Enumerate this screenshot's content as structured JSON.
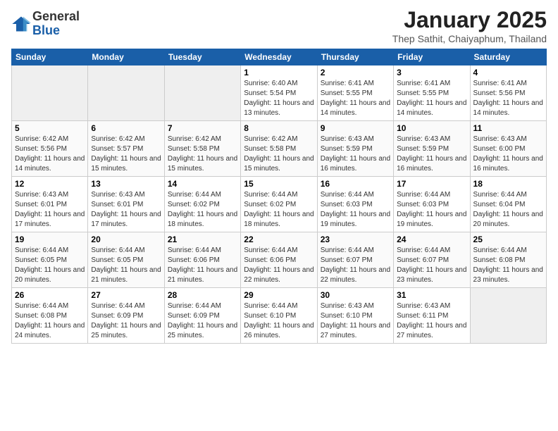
{
  "logo": {
    "general": "General",
    "blue": "Blue"
  },
  "header": {
    "month": "January 2025",
    "location": "Thep Sathit, Chaiyaphum, Thailand"
  },
  "weekdays": [
    "Sunday",
    "Monday",
    "Tuesday",
    "Wednesday",
    "Thursday",
    "Friday",
    "Saturday"
  ],
  "weeks": [
    [
      {
        "day": null
      },
      {
        "day": null
      },
      {
        "day": null
      },
      {
        "day": "1",
        "sunrise": "6:40 AM",
        "sunset": "5:54 PM",
        "daylight": "11 hours and 13 minutes."
      },
      {
        "day": "2",
        "sunrise": "6:41 AM",
        "sunset": "5:55 PM",
        "daylight": "11 hours and 14 minutes."
      },
      {
        "day": "3",
        "sunrise": "6:41 AM",
        "sunset": "5:55 PM",
        "daylight": "11 hours and 14 minutes."
      },
      {
        "day": "4",
        "sunrise": "6:41 AM",
        "sunset": "5:56 PM",
        "daylight": "11 hours and 14 minutes."
      }
    ],
    [
      {
        "day": "5",
        "sunrise": "6:42 AM",
        "sunset": "5:56 PM",
        "daylight": "11 hours and 14 minutes."
      },
      {
        "day": "6",
        "sunrise": "6:42 AM",
        "sunset": "5:57 PM",
        "daylight": "11 hours and 15 minutes."
      },
      {
        "day": "7",
        "sunrise": "6:42 AM",
        "sunset": "5:58 PM",
        "daylight": "11 hours and 15 minutes."
      },
      {
        "day": "8",
        "sunrise": "6:42 AM",
        "sunset": "5:58 PM",
        "daylight": "11 hours and 15 minutes."
      },
      {
        "day": "9",
        "sunrise": "6:43 AM",
        "sunset": "5:59 PM",
        "daylight": "11 hours and 16 minutes."
      },
      {
        "day": "10",
        "sunrise": "6:43 AM",
        "sunset": "5:59 PM",
        "daylight": "11 hours and 16 minutes."
      },
      {
        "day": "11",
        "sunrise": "6:43 AM",
        "sunset": "6:00 PM",
        "daylight": "11 hours and 16 minutes."
      }
    ],
    [
      {
        "day": "12",
        "sunrise": "6:43 AM",
        "sunset": "6:01 PM",
        "daylight": "11 hours and 17 minutes."
      },
      {
        "day": "13",
        "sunrise": "6:43 AM",
        "sunset": "6:01 PM",
        "daylight": "11 hours and 17 minutes."
      },
      {
        "day": "14",
        "sunrise": "6:44 AM",
        "sunset": "6:02 PM",
        "daylight": "11 hours and 18 minutes."
      },
      {
        "day": "15",
        "sunrise": "6:44 AM",
        "sunset": "6:02 PM",
        "daylight": "11 hours and 18 minutes."
      },
      {
        "day": "16",
        "sunrise": "6:44 AM",
        "sunset": "6:03 PM",
        "daylight": "11 hours and 19 minutes."
      },
      {
        "day": "17",
        "sunrise": "6:44 AM",
        "sunset": "6:03 PM",
        "daylight": "11 hours and 19 minutes."
      },
      {
        "day": "18",
        "sunrise": "6:44 AM",
        "sunset": "6:04 PM",
        "daylight": "11 hours and 20 minutes."
      }
    ],
    [
      {
        "day": "19",
        "sunrise": "6:44 AM",
        "sunset": "6:05 PM",
        "daylight": "11 hours and 20 minutes."
      },
      {
        "day": "20",
        "sunrise": "6:44 AM",
        "sunset": "6:05 PM",
        "daylight": "11 hours and 21 minutes."
      },
      {
        "day": "21",
        "sunrise": "6:44 AM",
        "sunset": "6:06 PM",
        "daylight": "11 hours and 21 minutes."
      },
      {
        "day": "22",
        "sunrise": "6:44 AM",
        "sunset": "6:06 PM",
        "daylight": "11 hours and 22 minutes."
      },
      {
        "day": "23",
        "sunrise": "6:44 AM",
        "sunset": "6:07 PM",
        "daylight": "11 hours and 22 minutes."
      },
      {
        "day": "24",
        "sunrise": "6:44 AM",
        "sunset": "6:07 PM",
        "daylight": "11 hours and 23 minutes."
      },
      {
        "day": "25",
        "sunrise": "6:44 AM",
        "sunset": "6:08 PM",
        "daylight": "11 hours and 23 minutes."
      }
    ],
    [
      {
        "day": "26",
        "sunrise": "6:44 AM",
        "sunset": "6:08 PM",
        "daylight": "11 hours and 24 minutes."
      },
      {
        "day": "27",
        "sunrise": "6:44 AM",
        "sunset": "6:09 PM",
        "daylight": "11 hours and 25 minutes."
      },
      {
        "day": "28",
        "sunrise": "6:44 AM",
        "sunset": "6:09 PM",
        "daylight": "11 hours and 25 minutes."
      },
      {
        "day": "29",
        "sunrise": "6:44 AM",
        "sunset": "6:10 PM",
        "daylight": "11 hours and 26 minutes."
      },
      {
        "day": "30",
        "sunrise": "6:43 AM",
        "sunset": "6:10 PM",
        "daylight": "11 hours and 27 minutes."
      },
      {
        "day": "31",
        "sunrise": "6:43 AM",
        "sunset": "6:11 PM",
        "daylight": "11 hours and 27 minutes."
      },
      {
        "day": null
      }
    ]
  ],
  "labels": {
    "sunrise": "Sunrise:",
    "sunset": "Sunset:",
    "daylight": "Daylight:"
  }
}
